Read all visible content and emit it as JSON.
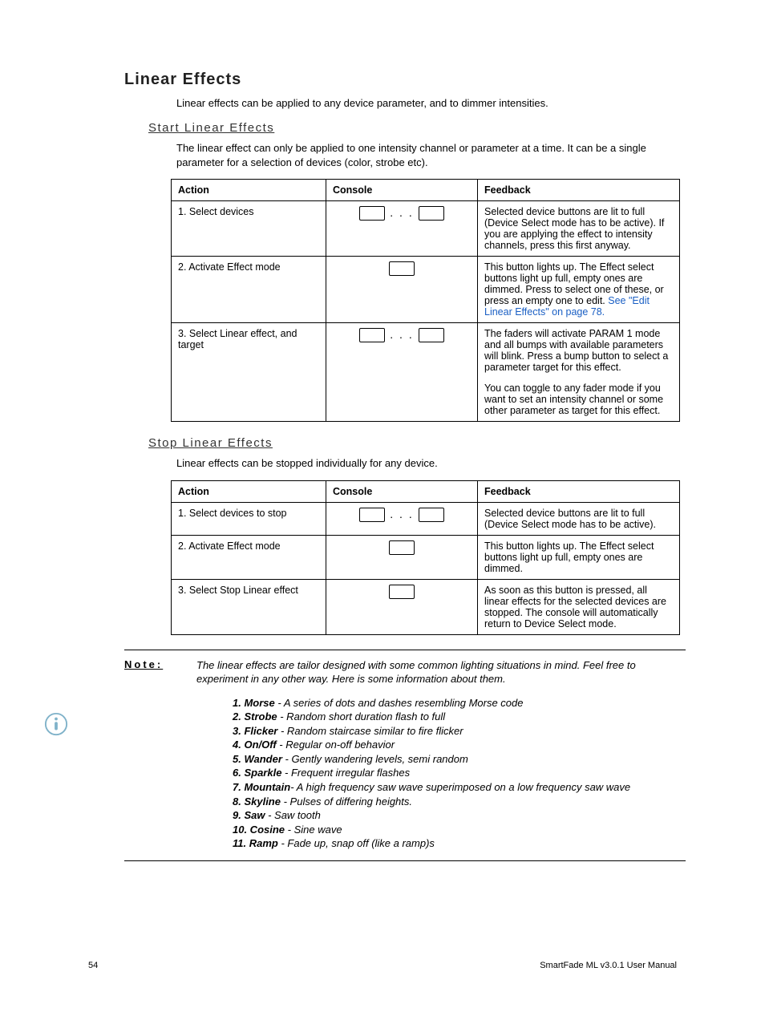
{
  "title": "Linear Effects",
  "intro": "Linear effects can be applied to any device parameter, and to dimmer intensities.",
  "sections": {
    "start": {
      "heading": "Start Linear Effects",
      "para": "The linear effect can only be applied to one intensity channel or parameter at a time. It can be a single parameter for a selection of devices (color, strobe etc).",
      "headers": {
        "action": "Action",
        "console": "Console",
        "feedback": "Feedback"
      },
      "rows": [
        {
          "action": "1. Select devices",
          "feedback": "Selected device buttons are lit to full (Device Select mode has to be active). If you are applying the effect to intensity channels, press this first anyway."
        },
        {
          "action": "2. Activate Effect mode",
          "feedback_pre": "This button lights up. The Effect select buttons light up full, empty ones are dimmed. Press to select one of these, or press an empty one to edit. ",
          "feedback_link": "See \"Edit Linear Effects\" on page 78.",
          "feedback_post": ""
        },
        {
          "action": "3. Select Linear effect, and target",
          "feedback_p1": "The faders will activate PARAM 1 mode and all bumps with available parameters will blink. Press a bump button to select a parameter target for this effect.",
          "feedback_p2": "You can toggle to any fader mode if you want to set an intensity channel or some other parameter as target for this effect."
        }
      ]
    },
    "stop": {
      "heading": "Stop Linear Effects",
      "para": "Linear effects can be stopped individually for any device.",
      "headers": {
        "action": "Action",
        "console": "Console",
        "feedback": "Feedback"
      },
      "rows": [
        {
          "action": "1. Select devices to stop",
          "feedback": "Selected device buttons are lit to full (Device Select mode has to be active)."
        },
        {
          "action": "2. Activate Effect mode",
          "feedback": "This button lights up. The Effect select buttons light up full, empty ones are dimmed."
        },
        {
          "action": "3. Select Stop Linear effect",
          "feedback": "As soon as this button is pressed, all linear effects for the selected devices are stopped. The console will automatically return to Device Select mode."
        }
      ]
    }
  },
  "note": {
    "label": "Note:",
    "text": "The linear effects are tailor designed with some common lighting situations in mind. Feel free to experiment in any other way. Here is some information about them.",
    "items": [
      {
        "num": "1.",
        "name": "Morse",
        "sep": " - ",
        "desc": "A series of dots and dashes resembling Morse code"
      },
      {
        "num": "2.",
        "name": "Strobe",
        "sep": " - ",
        "desc": "Random short duration flash to full"
      },
      {
        "num": "3.",
        "name": "Flicker",
        "sep": " - ",
        "desc": "Random staircase similar to fire flicker"
      },
      {
        "num": "4.",
        "name": "On/Off",
        "sep": " - ",
        "desc": "Regular on-off behavior"
      },
      {
        "num": "5.",
        "name": "Wander",
        "sep": " - ",
        "desc": "Gently wandering levels, semi random"
      },
      {
        "num": "6.",
        "name": "Sparkle",
        "sep": " - ",
        "desc": "Frequent irregular flashes"
      },
      {
        "num": "7.",
        "name": "Mountain",
        "sep": "- ",
        "desc": "A high frequency saw wave superimposed on a low frequency saw wave"
      },
      {
        "num": "8.",
        "name": "Skyline",
        "sep": " - ",
        "desc": "Pulses of differing heights."
      },
      {
        "num": "9.",
        "name": "Saw",
        "sep": " - ",
        "desc": "Saw tooth"
      },
      {
        "num": "10.",
        "name": "Cosine",
        "sep": " - ",
        "desc": "Sine wave"
      },
      {
        "num": "11.",
        "name": "Ramp",
        "sep": " - ",
        "desc": "Fade up, snap off (like a ramp)s"
      }
    ]
  },
  "footer": {
    "page": "54",
    "doc": "SmartFade ML v3.0.1 User Manual"
  }
}
